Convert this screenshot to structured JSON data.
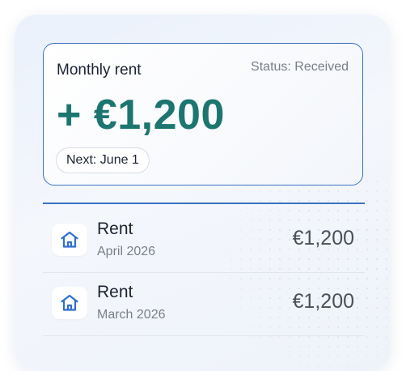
{
  "summary": {
    "title": "Monthly rent",
    "status": "Status: Received",
    "amount": "+ €1,200",
    "next": "Next: June 1"
  },
  "transactions": [
    {
      "name": "Rent",
      "date": "April 2026",
      "amount": "€1,200",
      "icon": "house-icon"
    },
    {
      "name": "Rent",
      "date": "March 2026",
      "amount": "€1,200",
      "icon": "house-icon"
    }
  ],
  "colors": {
    "accent": "#3b73c0",
    "amount": "#1d7570",
    "icon": "#2f6fd0"
  }
}
